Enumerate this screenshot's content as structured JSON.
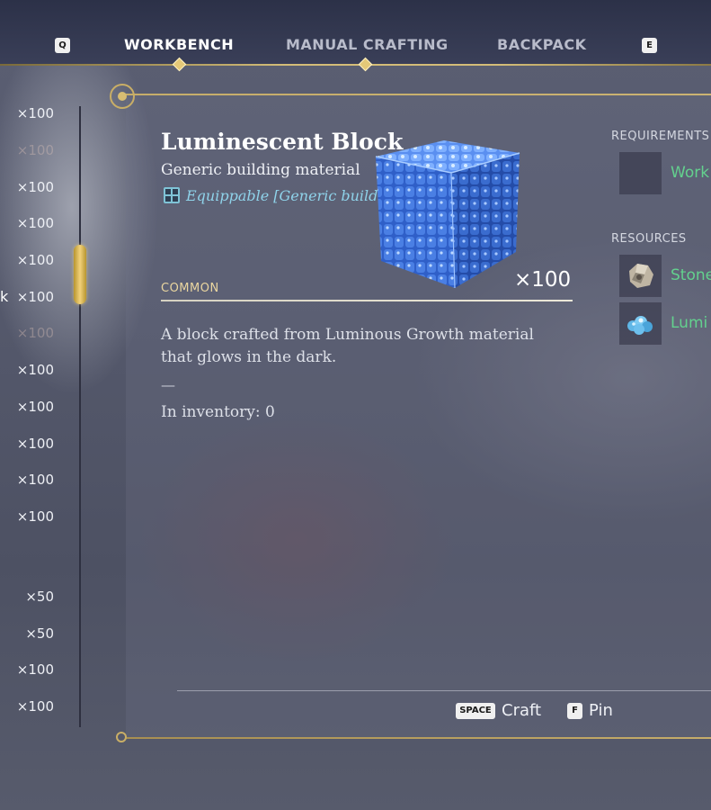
{
  "tabs": {
    "prev_key": "Q",
    "next_key": "E",
    "items": [
      {
        "label": "WORKBENCH",
        "active": true
      },
      {
        "label": "MANUAL CRAFTING",
        "active": false
      },
      {
        "label": "BACKPACK",
        "active": false
      }
    ]
  },
  "recipe_list": {
    "scroll_position": 0.25,
    "partial_name": "k",
    "quantities": [
      "×100",
      "×100",
      "×100",
      "×100",
      "×100",
      "×100",
      "×100",
      "×100",
      "×100",
      "×100",
      "×100",
      "×100",
      "×50",
      "×50",
      "×100",
      "×100"
    ]
  },
  "item": {
    "name": "Luminescent Block",
    "subtitle": "Generic building material",
    "tag_icon": "grid-block-icon",
    "tag_text": "Equippable [Generic building material]",
    "craft_quantity": "×100",
    "rarity": "COMMON",
    "description": "A block crafted from Luminous Growth material that glows in the dark.",
    "separator": "—",
    "inventory": "In inventory: 0"
  },
  "requirements": {
    "heading": "REQUIREMENTS",
    "items": [
      {
        "name": "Work",
        "icon": "empty-slot"
      }
    ]
  },
  "resources": {
    "heading": "RESOURCES",
    "items": [
      {
        "name": "Stone",
        "icon": "stone-icon"
      },
      {
        "name": "Lumi",
        "icon": "crystal-icon"
      }
    ]
  },
  "actions": {
    "craft_key": "SPACE",
    "craft_label": "Craft",
    "pin_key": "F",
    "pin_label": "Pin"
  },
  "colors": {
    "gold": "#d4bd78",
    "resource_green": "#63d18e",
    "tag_blue": "#8fd3ea",
    "cube_blue": "#3f7fe0"
  }
}
